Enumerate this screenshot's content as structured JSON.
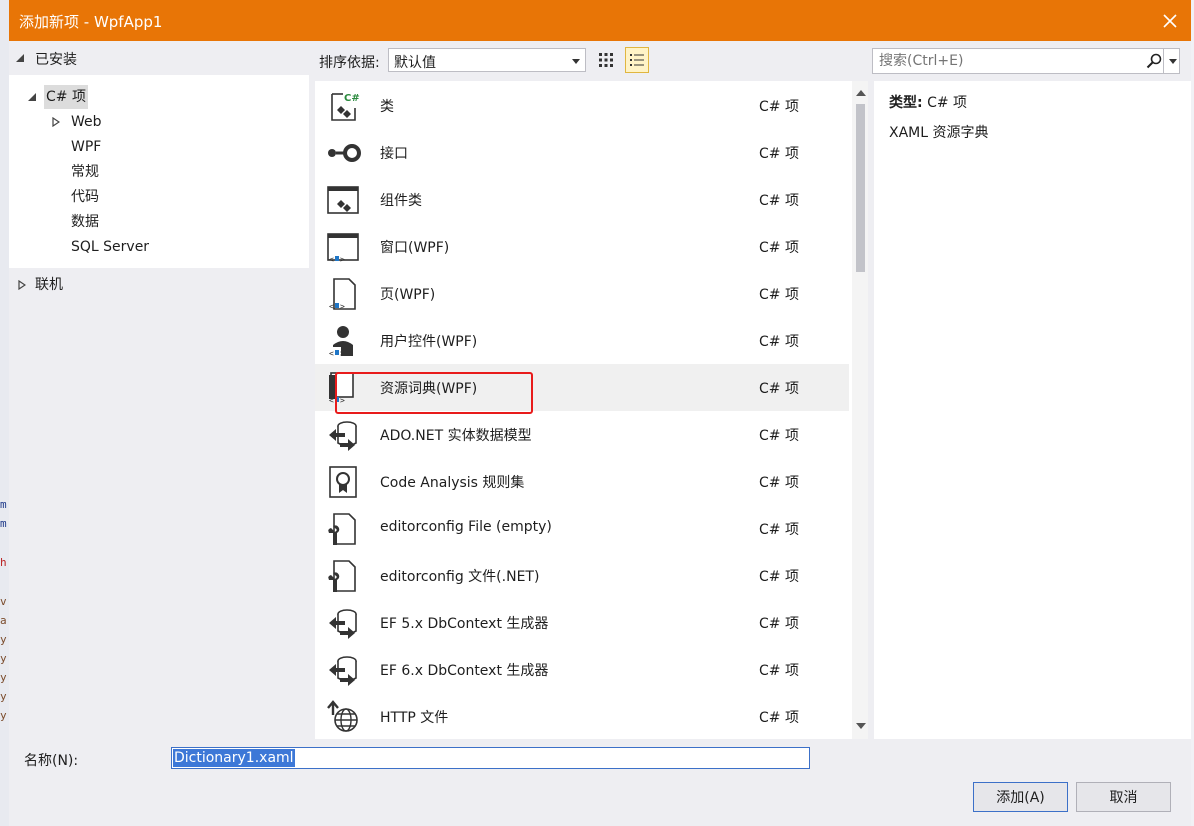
{
  "window": {
    "title": "添加新项 - WpfApp1"
  },
  "left_tree": {
    "installed_label": "已安装",
    "root_label": "C# 项",
    "children": [
      "Web",
      "WPF",
      "常规",
      "代码",
      "数据",
      "SQL Server"
    ],
    "online_label": "联机"
  },
  "toolbar": {
    "sort_label": "排序依据:",
    "sort_value": "默认值",
    "search_placeholder": "搜索(Ctrl+E)"
  },
  "items": [
    {
      "name": "类",
      "type": "C# 项",
      "icon": "class-icon"
    },
    {
      "name": "接口",
      "type": "C# 项",
      "icon": "interface-icon"
    },
    {
      "name": "组件类",
      "type": "C# 项",
      "icon": "component-class-icon"
    },
    {
      "name": "窗口(WPF)",
      "type": "C# 项",
      "icon": "window-icon"
    },
    {
      "name": "页(WPF)",
      "type": "C# 项",
      "icon": "page-icon"
    },
    {
      "name": "用户控件(WPF)",
      "type": "C# 项",
      "icon": "user-control-icon"
    },
    {
      "name": "资源词典(WPF)",
      "type": "C# 项",
      "icon": "resource-dictionary-icon",
      "selected": true
    },
    {
      "name": "ADO.NET 实体数据模型",
      "type": "C# 项",
      "icon": "entity-model-icon"
    },
    {
      "name": "Code Analysis 规则集",
      "type": "C# 项",
      "icon": "ruleset-icon"
    },
    {
      "name": "editorconfig File (empty)",
      "type": "C# 项",
      "icon": "editorconfig-icon"
    },
    {
      "name": "editorconfig 文件(.NET)",
      "type": "C# 项",
      "icon": "editorconfig-icon"
    },
    {
      "name": "EF 5.x DbContext 生成器",
      "type": "C# 项",
      "icon": "ef-generator-icon"
    },
    {
      "name": "EF 6.x DbContext 生成器",
      "type": "C# 项",
      "icon": "ef-generator-icon"
    },
    {
      "name": "HTTP 文件",
      "type": "C# 项",
      "icon": "http-file-icon"
    }
  ],
  "details": {
    "type_label": "类型:",
    "type_value": "C# 项",
    "description": "XAML 资源字典"
  },
  "bottom": {
    "name_label": "名称(N):",
    "name_value": "Dictionary1.xaml",
    "add_button": "添加(A)",
    "cancel_button": "取消"
  },
  "background_code": [
    "m",
    "m",
    "h",
    "v",
    "a",
    "y",
    "y",
    "y",
    "y",
    "y"
  ],
  "colors": {
    "titlebar": "#e87506",
    "highlight": "#e81b1b",
    "selection": "#3d78d7"
  }
}
